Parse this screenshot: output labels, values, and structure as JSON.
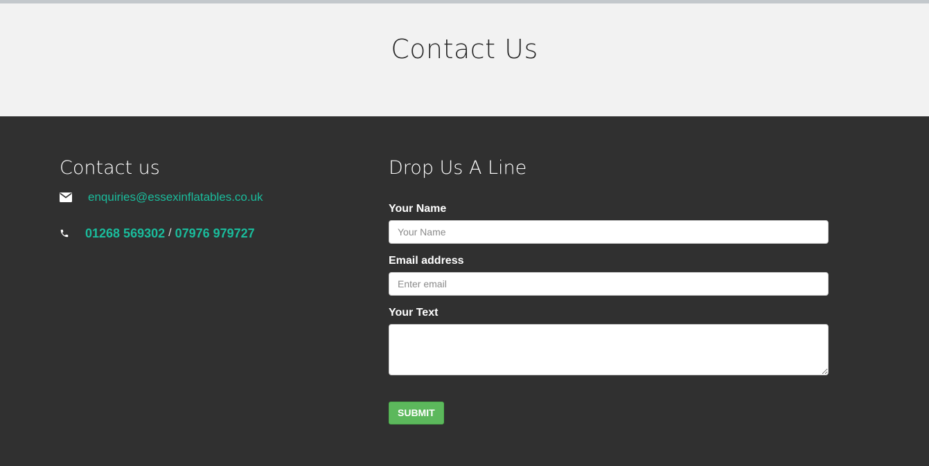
{
  "banner": {
    "title": "Contact Us"
  },
  "contact": {
    "heading": "Contact us",
    "email": "enquiries@essexinflatables.co.uk",
    "phone_1": "01268 569302",
    "separator": "/",
    "phone_2": "07976 979727",
    "icons": {
      "email": "envelope-icon",
      "phone": "phone-icon"
    }
  },
  "form": {
    "heading": "Drop Us A Line",
    "name_label": "Your Name",
    "name_placeholder": "Your Name",
    "name_value": "",
    "email_label": "Email address",
    "email_placeholder": "Enter email",
    "email_value": "",
    "text_label": "Your Text",
    "text_value": "",
    "submit_label": "SUBMIT"
  },
  "colors": {
    "accent": "#1abc9c",
    "submit": "#5cb85c",
    "dark_bg": "#303030",
    "banner_bg": "#f2f2f2"
  }
}
